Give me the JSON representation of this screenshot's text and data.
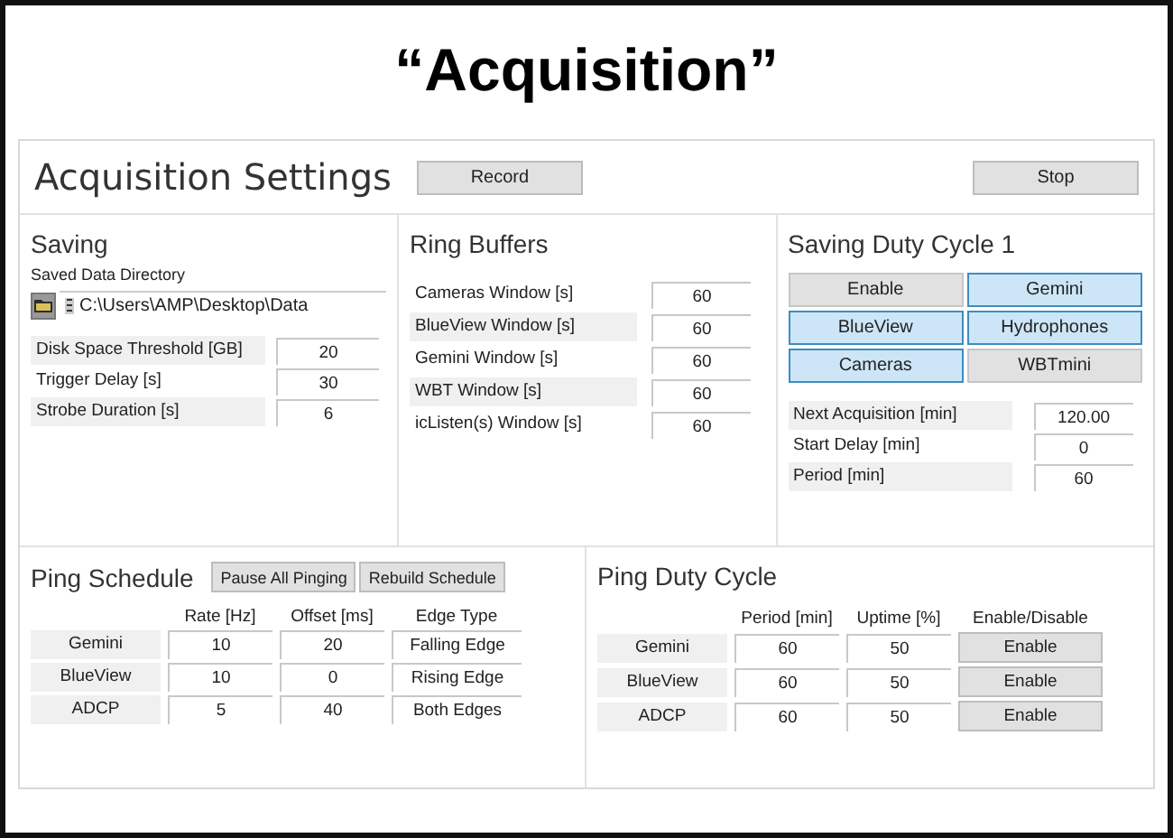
{
  "slide_title": "“Acquisition”",
  "header": {
    "title": "Acquisition Settings",
    "buttons": [
      "Record",
      "Stop"
    ]
  },
  "saving": {
    "title": "Saving",
    "directory_label": "Saved Data Directory",
    "directory_path": "C:\\Users\\AMP\\Desktop\\Data",
    "fields": [
      {
        "label": "Disk Space Threshold [GB]",
        "value": "20"
      },
      {
        "label": "Trigger Delay [s]",
        "value": "30"
      },
      {
        "label": "Strobe Duration [s]",
        "value": "6"
      }
    ]
  },
  "ring_buffers": {
    "title": "Ring Buffers",
    "fields": [
      {
        "label": "Cameras Window [s]",
        "value": "60"
      },
      {
        "label": "BlueView Window [s]",
        "value": "60"
      },
      {
        "label": "Gemini Window [s]",
        "value": "60"
      },
      {
        "label": "WBT Window [s]",
        "value": "60"
      },
      {
        "label": "icListen(s) Window [s]",
        "value": "60"
      }
    ]
  },
  "saving_duty_cycle": {
    "title": "Saving Duty Cycle 1",
    "toggles": [
      {
        "label": "Enable",
        "on": false
      },
      {
        "label": "Gemini",
        "on": true
      },
      {
        "label": "BlueView",
        "on": true
      },
      {
        "label": "Hydrophones",
        "on": true
      },
      {
        "label": "Cameras",
        "on": true
      },
      {
        "label": "WBTmini",
        "on": false
      }
    ],
    "fields": [
      {
        "label": "Next Acquisition [min]",
        "value": "120.00"
      },
      {
        "label": "Start Delay [min]",
        "value": "0"
      },
      {
        "label": "Period [min]",
        "value": "60"
      }
    ]
  },
  "ping_schedule": {
    "title": "Ping Schedule",
    "buttons": [
      "Pause All Pinging",
      "Rebuild Schedule"
    ],
    "columns": [
      "Rate [Hz]",
      "Offset [ms]",
      "Edge Type"
    ],
    "rows": [
      {
        "name": "Gemini",
        "cells": [
          "10",
          "20",
          "Falling Edge"
        ]
      },
      {
        "name": "BlueView",
        "cells": [
          "10",
          "0",
          "Rising Edge"
        ]
      },
      {
        "name": "ADCP",
        "cells": [
          "5",
          "40",
          "Both Edges"
        ]
      }
    ]
  },
  "ping_duty_cycle": {
    "title": "Ping Duty Cycle",
    "columns": [
      "Period [min]",
      "Uptime [%]",
      "Enable/Disable"
    ],
    "rows": [
      {
        "name": "Gemini",
        "cells": [
          "60",
          "50"
        ],
        "action": "Enable"
      },
      {
        "name": "BlueView",
        "cells": [
          "60",
          "50"
        ],
        "action": "Enable"
      },
      {
        "name": "ADCP",
        "cells": [
          "60",
          "50"
        ],
        "action": "Enable"
      }
    ]
  }
}
